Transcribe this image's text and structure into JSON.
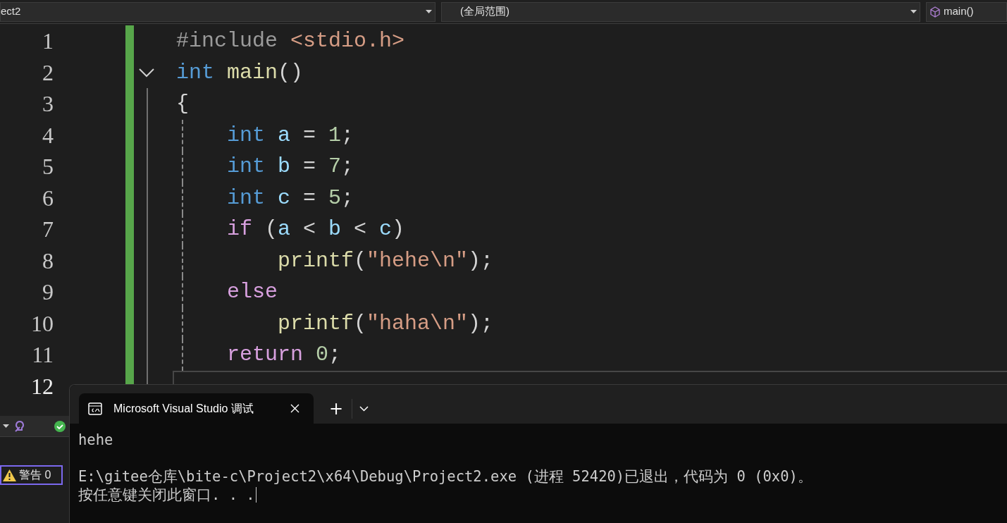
{
  "navbar": {
    "project_dropdown": "ect2",
    "scope_dropdown": "(全局范围)",
    "member_dropdown": "main()"
  },
  "editor": {
    "lines": [
      {
        "number": "1",
        "changed": true,
        "current": false,
        "tokens": [
          {
            "text": "#include ",
            "kind": "preprocessor"
          },
          {
            "text": "<stdio.h>",
            "kind": "string"
          }
        ]
      },
      {
        "number": "2",
        "changed": true,
        "current": false,
        "fold": {
          "expanded": true
        },
        "tokens": [
          {
            "text": "int ",
            "kind": "keyword"
          },
          {
            "text": "main",
            "kind": "function"
          },
          {
            "text": "()",
            "kind": "plain"
          }
        ]
      },
      {
        "number": "3",
        "changed": true,
        "current": false,
        "tokens": [
          {
            "text": "{",
            "kind": "plain"
          }
        ],
        "children": [
          {
            "number": "4",
            "changed": true,
            "current": false,
            "tokens": [
              {
                "text": "int ",
                "kind": "keyword"
              },
              {
                "text": "a",
                "kind": "variable"
              },
              {
                "text": " = ",
                "kind": "plain"
              },
              {
                "text": "1",
                "kind": "number"
              },
              {
                "text": ";",
                "kind": "plain"
              }
            ]
          },
          {
            "number": "5",
            "changed": true,
            "current": false,
            "tokens": [
              {
                "text": "int ",
                "kind": "keyword"
              },
              {
                "text": "b",
                "kind": "variable"
              },
              {
                "text": " = ",
                "kind": "plain"
              },
              {
                "text": "7",
                "kind": "number"
              },
              {
                "text": ";",
                "kind": "plain"
              }
            ]
          },
          {
            "number": "6",
            "changed": true,
            "current": false,
            "tokens": [
              {
                "text": "int ",
                "kind": "keyword"
              },
              {
                "text": "c",
                "kind": "variable"
              },
              {
                "text": " = ",
                "kind": "plain"
              },
              {
                "text": "5",
                "kind": "number"
              },
              {
                "text": ";",
                "kind": "plain"
              }
            ]
          },
          {
            "number": "7",
            "changed": true,
            "current": false,
            "tokens": [
              {
                "text": "if",
                "kind": "control"
              },
              {
                "text": " (",
                "kind": "plain"
              },
              {
                "text": "a",
                "kind": "variable"
              },
              {
                "text": " < ",
                "kind": "plain"
              },
              {
                "text": "b",
                "kind": "variable"
              },
              {
                "text": " < ",
                "kind": "plain"
              },
              {
                "text": "c",
                "kind": "variable"
              },
              {
                "text": ")",
                "kind": "plain"
              }
            ],
            "children": [
              {
                "number": "8",
                "changed": true,
                "current": false,
                "tokens": [
                  {
                    "text": "printf",
                    "kind": "function"
                  },
                  {
                    "text": "(",
                    "kind": "plain"
                  },
                  {
                    "text": "\"hehe\\n\"",
                    "kind": "string"
                  },
                  {
                    "text": ");",
                    "kind": "plain"
                  }
                ]
              }
            ]
          },
          {
            "number": "9",
            "changed": true,
            "current": false,
            "tokens": [
              {
                "text": "else",
                "kind": "control"
              }
            ],
            "children": [
              {
                "number": "10",
                "changed": true,
                "current": false,
                "tokens": [
                  {
                    "text": "printf",
                    "kind": "function"
                  },
                  {
                    "text": "(",
                    "kind": "plain"
                  },
                  {
                    "text": "\"haha\\n\"",
                    "kind": "string"
                  },
                  {
                    "text": ");",
                    "kind": "plain"
                  }
                ]
              }
            ]
          },
          {
            "number": "11",
            "changed": true,
            "current": false,
            "tokens": [
              {
                "text": "return ",
                "kind": "control"
              },
              {
                "text": "0",
                "kind": "number"
              },
              {
                "text": ";",
                "kind": "plain"
              }
            ]
          }
        ]
      },
      {
        "number": "12",
        "changed": true,
        "current": true
      }
    ]
  },
  "error_list": {
    "warnings_button": "警告 0"
  },
  "console": {
    "tab_title": "Microsoft Visual Studio 调试",
    "new_tab": "+",
    "output_blocks": [
      [
        "hehe"
      ],
      [
        "E:\\gitee仓库\\bite-c\\Project2\\x64\\Debug\\Project2.exe (进程 52420)已退出，代码为 0 (0x0)。",
        "按任意键关闭此窗口. . ."
      ]
    ]
  }
}
